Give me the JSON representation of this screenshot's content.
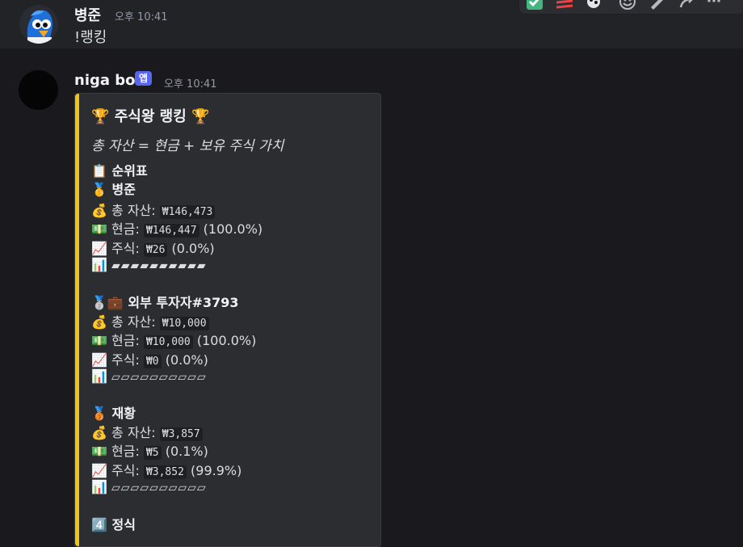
{
  "message1": {
    "author": "병준",
    "time": "오후 10:41",
    "content": "!랭킹"
  },
  "message2": {
    "author": "niga bot",
    "badge": "앱",
    "time": "오후 10:41"
  },
  "embed": {
    "accent_color": "#f1c40f",
    "title": "주식왕 랭킹",
    "subtitle": "총 자산 = 현금 + 보유 주식 가치",
    "section_title": "순위표",
    "entries": [
      {
        "name": "병준",
        "total_label": "총 자산:",
        "total": "₩146,473",
        "cash_label": "현금:",
        "cash": "₩146,447",
        "cash_pct": "(100.0%)",
        "stock_label": "주식:",
        "stock": "₩26",
        "stock_pct": "(0.0%)",
        "bar": "▰▰▰▰▰▰▰▰▰▰"
      },
      {
        "name": "외부 투자자#3793",
        "total_label": "총 자산:",
        "total": "₩10,000",
        "cash_label": "현금:",
        "cash": "₩10,000",
        "cash_pct": "(100.0%)",
        "stock_label": "주식:",
        "stock": "₩0",
        "stock_pct": "(0.0%)",
        "bar": "▱▱▱▱▱▱▱▱▱▱"
      },
      {
        "name": "재황",
        "total_label": "총 자산:",
        "total": "₩3,857",
        "cash_label": "현금:",
        "cash": "₩5",
        "cash_pct": "(0.1%)",
        "stock_label": "주식:",
        "stock": "₩3,852",
        "stock_pct": "(99.9%)",
        "bar": "▱▱▱▱▱▱▱▱▱▱"
      },
      {
        "name": "정식"
      }
    ]
  },
  "icons": [
    "trophy-icon",
    "clipboard-icon",
    "medal-1-icon",
    "medal-2-icon",
    "medal-3-icon",
    "briefcase-icon",
    "money-bag-icon",
    "banknote-icon",
    "chart-up-icon",
    "bar-chart-icon",
    "keycap-4-icon",
    "checkmark-icon",
    "react-icon",
    "edit-icon",
    "reply-icon",
    "more-icon"
  ]
}
